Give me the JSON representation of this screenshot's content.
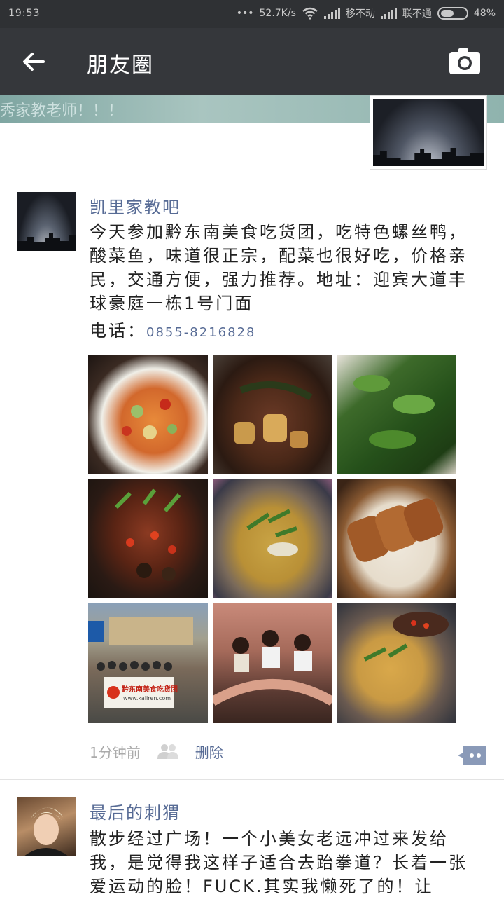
{
  "status_bar": {
    "time": "19:53",
    "dots": "•••",
    "speed": "52.7K/s",
    "carrier1": "移不动",
    "carrier2": "联不通",
    "battery": "48%"
  },
  "header": {
    "title": "朋友圈",
    "back_icon": "arrow-left-icon",
    "camera_icon": "camera-icon"
  },
  "cover": {
    "text": "秀家教老师！！！"
  },
  "posts": [
    {
      "author": "凯里家教吧",
      "text": "今天参加黔东南美食吃货团，吃特色螺丝鸭，酸菜鱼，味道很正宗，配菜也很好吃，价格亲民，交通方便，强力推荐。地址：迎宾大道丰球豪庭一栋1号门面",
      "phone_label": "电话：",
      "phone_number": "0855-8216828",
      "photos": [
        "photo-food-1",
        "photo-food-2",
        "photo-food-3",
        "photo-food-4",
        "photo-food-5",
        "photo-food-6",
        "photo-group-banner",
        "photo-group-toast",
        "photo-food-9"
      ],
      "banner_text": "黔东南美食吃货团",
      "banner_url": "www.kaliren.com",
      "time": "1分钟前",
      "delete_label": "删除"
    },
    {
      "author": "最后的刺猬",
      "text": "散步经过广场！一个小美女老远冲过来发给我，是觉得我这样子适合去跆拳道？长着一张爱运动的脸！FUCK.其实我懒死了的！让"
    }
  ],
  "colors": {
    "link": "#576b95",
    "titlebar": "#35373b",
    "statusbar": "#2f3134"
  }
}
